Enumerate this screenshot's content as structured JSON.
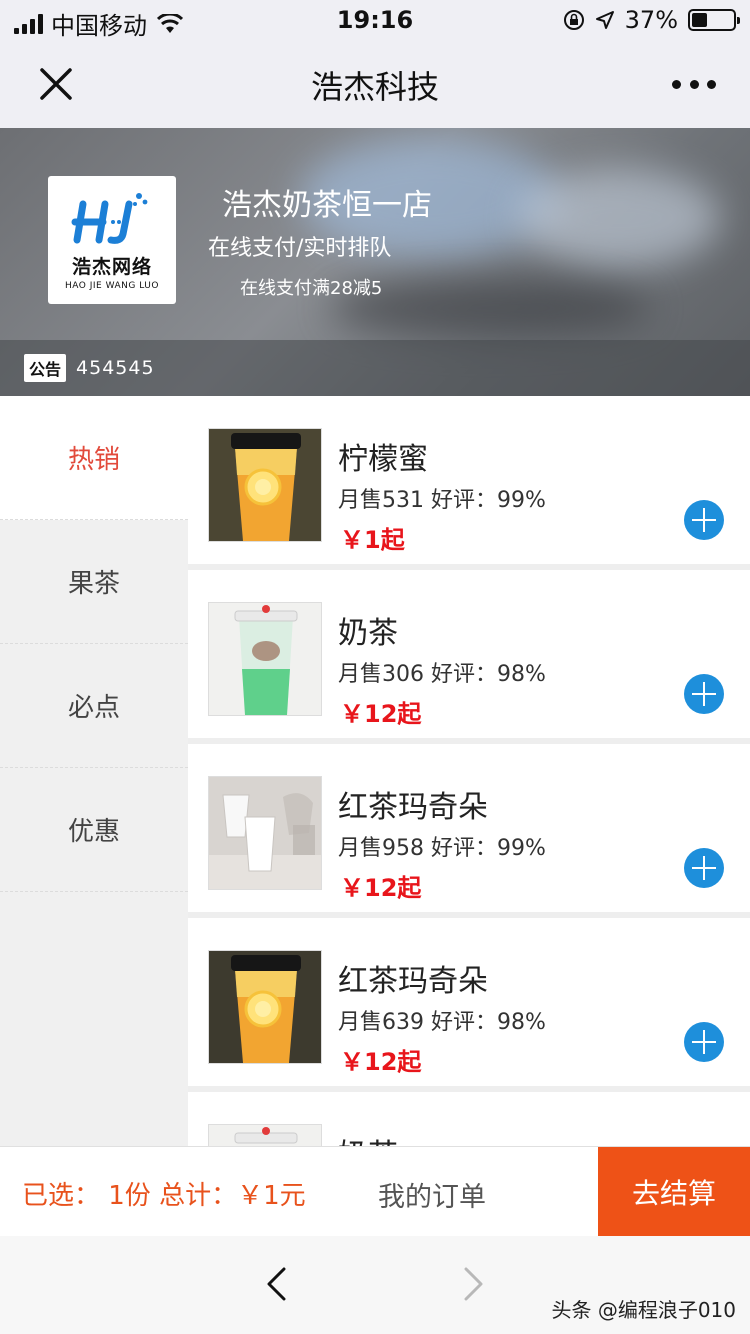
{
  "status_bar": {
    "carrier": "中国移动",
    "time": "19:16",
    "battery": "37%",
    "battery_level": 0.37
  },
  "nav": {
    "title": "浩杰科技"
  },
  "shop": {
    "logo_text_cn": "浩杰网络",
    "logo_text_en": "HAO JIE WANG LUO",
    "name": "浩杰奶茶恒一店",
    "subtitle": "在线支付/实时排队",
    "promo": "在线支付满28减5",
    "notice_tag": "公告",
    "notice_text": "454545"
  },
  "categories": [
    {
      "label": "热销",
      "active": true
    },
    {
      "label": "果茶",
      "active": false
    },
    {
      "label": "必点",
      "active": false
    },
    {
      "label": "优惠",
      "active": false
    }
  ],
  "products": [
    {
      "name": "柠檬蜜",
      "stats": "月售531 好评：99%",
      "price": "￥1起",
      "image": "lemon-tea-cup"
    },
    {
      "name": "奶茶",
      "stats": "月售306 好评：98%",
      "price": "￥12起",
      "image": "green-milk-tea-cup"
    },
    {
      "name": "红茶玛奇朵",
      "stats": "月售958 好评：99%",
      "price": "￥12起",
      "image": "white-cups"
    },
    {
      "name": "红茶玛奇朵",
      "stats": "月售639 好评：98%",
      "price": "￥12起",
      "image": "lemon-tea-cup"
    },
    {
      "name": "奶茶",
      "stats": "",
      "price": "",
      "image": "green-milk-tea-cup"
    }
  ],
  "cart": {
    "summary": "已选： 1份 总计：￥1元",
    "my_orders": "我的订单",
    "checkout": "去结算"
  },
  "watermark": "头条 @编程浪子010",
  "colors": {
    "accent_red": "#e24a3b",
    "price_red": "#e8151b",
    "add_blue": "#1e8fdb",
    "checkout_orange": "#ee5217"
  }
}
